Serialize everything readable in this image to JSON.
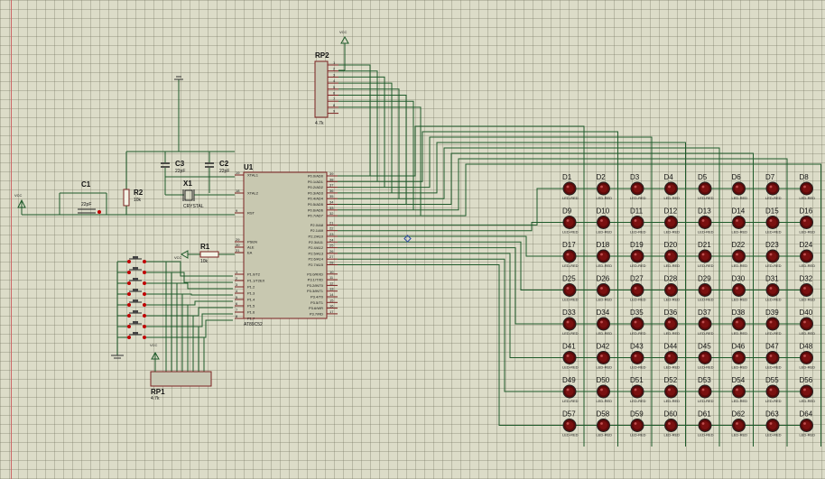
{
  "power": {
    "vcc": "VCC"
  },
  "mcu": {
    "ref": "U1",
    "part": "AT89C52",
    "left_pins": [
      {
        "num": "19",
        "name": "XTAL1"
      },
      {
        "num": "18",
        "name": "XTAL2"
      },
      {
        "num": "9",
        "name": "RST"
      },
      {
        "num": "29",
        "name": "PSEN"
      },
      {
        "num": "30",
        "name": "ALE"
      },
      {
        "num": "31",
        "name": "EA"
      },
      {
        "num": "1",
        "name": "P1.0/T2"
      },
      {
        "num": "2",
        "name": "P1.1/T2EX"
      },
      {
        "num": "3",
        "name": "P1.2"
      },
      {
        "num": "4",
        "name": "P1.3"
      },
      {
        "num": "5",
        "name": "P1.4"
      },
      {
        "num": "6",
        "name": "P1.5"
      },
      {
        "num": "7",
        "name": "P1.6"
      },
      {
        "num": "8",
        "name": "P1.7"
      }
    ],
    "right_pins": [
      {
        "num": "39",
        "name": "P0.0/AD0"
      },
      {
        "num": "38",
        "name": "P0.1/AD1"
      },
      {
        "num": "37",
        "name": "P0.2/AD2"
      },
      {
        "num": "36",
        "name": "P0.3/AD3"
      },
      {
        "num": "35",
        "name": "P0.4/AD4"
      },
      {
        "num": "34",
        "name": "P0.5/AD5"
      },
      {
        "num": "33",
        "name": "P0.6/AD6"
      },
      {
        "num": "32",
        "name": "P0.7/AD7"
      },
      {
        "num": "21",
        "name": "P2.0/A8"
      },
      {
        "num": "22",
        "name": "P2.1/A9"
      },
      {
        "num": "23",
        "name": "P2.2/A10"
      },
      {
        "num": "24",
        "name": "P2.3/A11"
      },
      {
        "num": "25",
        "name": "P2.4/A12"
      },
      {
        "num": "26",
        "name": "P2.5/A13"
      },
      {
        "num": "27",
        "name": "P2.6/A14"
      },
      {
        "num": "28",
        "name": "P2.7/A15"
      },
      {
        "num": "10",
        "name": "P3.0/RXD"
      },
      {
        "num": "11",
        "name": "P3.1/TXD"
      },
      {
        "num": "12",
        "name": "P3.2/INT0"
      },
      {
        "num": "13",
        "name": "P3.3/INT1"
      },
      {
        "num": "14",
        "name": "P3.4/T0"
      },
      {
        "num": "15",
        "name": "P3.5/T1"
      },
      {
        "num": "16",
        "name": "P3.6/WR"
      },
      {
        "num": "17",
        "name": "P3.7/RD"
      }
    ]
  },
  "components": {
    "c1": {
      "ref": "C1",
      "value": "22pF"
    },
    "c2": {
      "ref": "C2",
      "value": "22pF"
    },
    "c3": {
      "ref": "C3",
      "value": "22pF"
    },
    "x1": {
      "ref": "X1",
      "value": "CRYSTAL"
    },
    "r1": {
      "ref": "R1",
      "value": "10k"
    },
    "r2": {
      "ref": "R2",
      "value": "10k"
    },
    "rp1": {
      "ref": "RP1",
      "value": "4.7k"
    },
    "rp2": {
      "ref": "RP2",
      "value": "4.7k"
    }
  },
  "led_part": "LED-RED",
  "led_grid": {
    "rows": 8,
    "cols": 8,
    "prefix": "D"
  }
}
